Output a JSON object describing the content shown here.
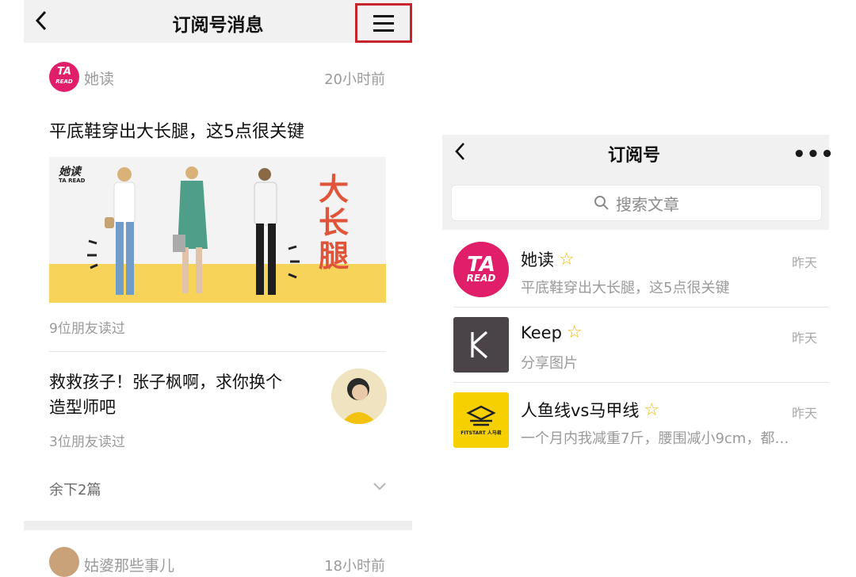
{
  "left": {
    "nav": {
      "title": "订阅号消息"
    },
    "article1": {
      "account": "她读",
      "avatar_text_top": "TA",
      "avatar_text_bottom": "READ",
      "time": "20小时前",
      "title": "平底鞋穿出大长腿，这5点很关键",
      "banner_logo_top": "她读",
      "banner_logo_bottom": "TA READ",
      "banner_text": [
        "大",
        "长",
        "腿"
      ],
      "readers": "9位朋友读过"
    },
    "article2": {
      "title_line1": "救救孩子！张子枫啊，求你换个",
      "title_line2": "造型师吧",
      "readers": "3位朋友读过"
    },
    "more": {
      "label": "余下2篇"
    },
    "article3": {
      "account": "姑婆那些事儿",
      "time": "18小时前"
    }
  },
  "right": {
    "nav": {
      "title": "订阅号"
    },
    "search": {
      "placeholder": "搜索文章"
    },
    "rows": [
      {
        "name": "她读",
        "subtitle": "平底鞋穿出大长腿，这5点很关键",
        "time": "昨天",
        "avatar_top": "TA",
        "avatar_bottom": "READ"
      },
      {
        "name": "Keep",
        "subtitle": "分享图片",
        "time": "昨天",
        "avatar_letter": "K"
      },
      {
        "name": "人鱼线vs马甲线",
        "subtitle": "一个月内我减重7斤，腰围减小9cm，都…",
        "time": "昨天",
        "avatar_label": "FITSTART 人马君"
      }
    ]
  },
  "colors": {
    "highlight_border": "#c8242b",
    "ta_pink": "#e01e6a",
    "keep_gray": "#4a4347",
    "fitstart_yellow": "#f7d000",
    "star": "#f2b705"
  }
}
